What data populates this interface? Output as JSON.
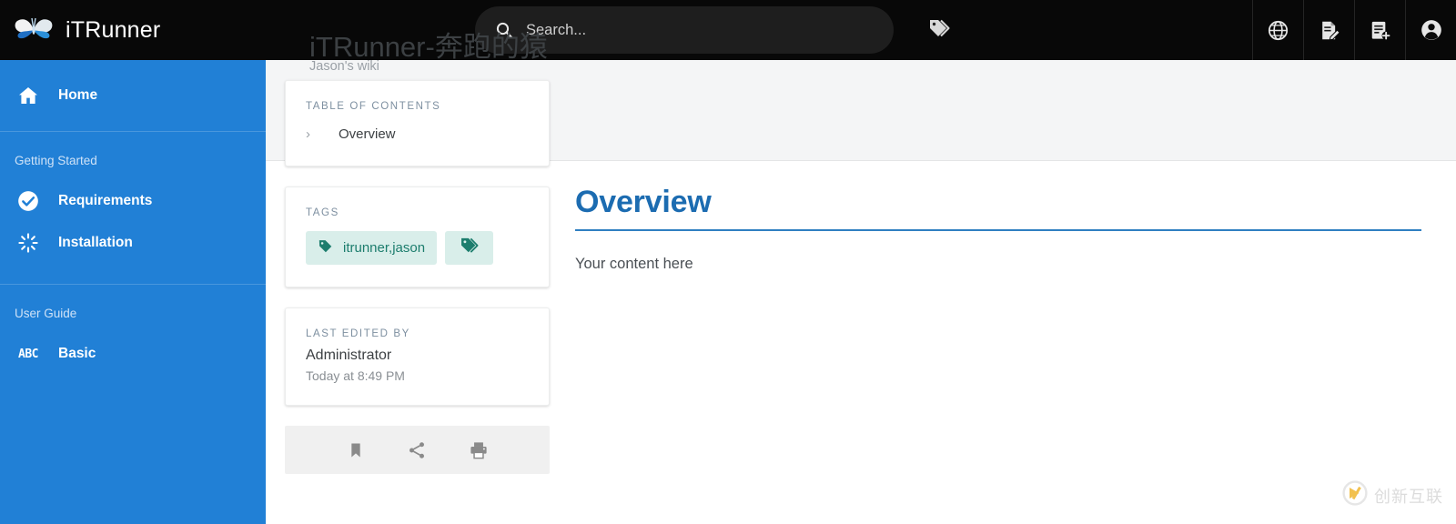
{
  "topbar": {
    "brand_title": "iTRunner",
    "logo_icon": "butterfly-logo",
    "search_placeholder": "Search...",
    "search_value": "",
    "search_icon": "search-icon",
    "tags_icon": "tags-icon",
    "right_icons": [
      {
        "name": "globe-icon",
        "label": "Language"
      },
      {
        "name": "edit-document-icon",
        "label": "Edit page"
      },
      {
        "name": "add-document-icon",
        "label": "New page"
      },
      {
        "name": "account-icon",
        "label": "Account"
      }
    ]
  },
  "sidebar": {
    "accent_color": "#2180d6",
    "items": [
      {
        "label": "Home",
        "icon": "home-icon",
        "type": "link"
      },
      {
        "label": "Getting Started",
        "icon": "",
        "type": "section"
      },
      {
        "label": "Requirements",
        "icon": "check-circle-icon",
        "type": "link"
      },
      {
        "label": "Installation",
        "icon": "spinner-icon",
        "type": "link"
      },
      {
        "label": "User Guide",
        "icon": "",
        "type": "section"
      },
      {
        "label": "Basic",
        "icon": "abc-icon",
        "type": "link"
      }
    ]
  },
  "header": {
    "title": "iTRunner-奔跑的猿",
    "subtitle": "Jason's wiki"
  },
  "cards": {
    "toc": {
      "label": "TABLE OF CONTENTS",
      "entries": [
        {
          "text": "Overview",
          "icon": "chevron-right-icon"
        }
      ]
    },
    "tags": {
      "label": "TAGS",
      "chip_color": "#1c7d6d",
      "chip_bg": "#d9eeea",
      "items": [
        {
          "text": "itrunner,jason",
          "icon": "tag-icon"
        }
      ],
      "more_icon": "tags-icon"
    },
    "last_edited": {
      "label": "LAST EDITED BY",
      "author": "Administrator",
      "time": "Today at 8:49 PM"
    },
    "actions": [
      {
        "name": "bookmark-icon",
        "label": "Bookmark"
      },
      {
        "name": "share-icon",
        "label": "Share"
      },
      {
        "name": "print-icon",
        "label": "Print"
      }
    ]
  },
  "content": {
    "heading": "Overview",
    "heading_color": "#1c6cb1",
    "body": "Your content here"
  },
  "watermark": {
    "text": "创新互联",
    "icon": "cx-logo-icon"
  }
}
